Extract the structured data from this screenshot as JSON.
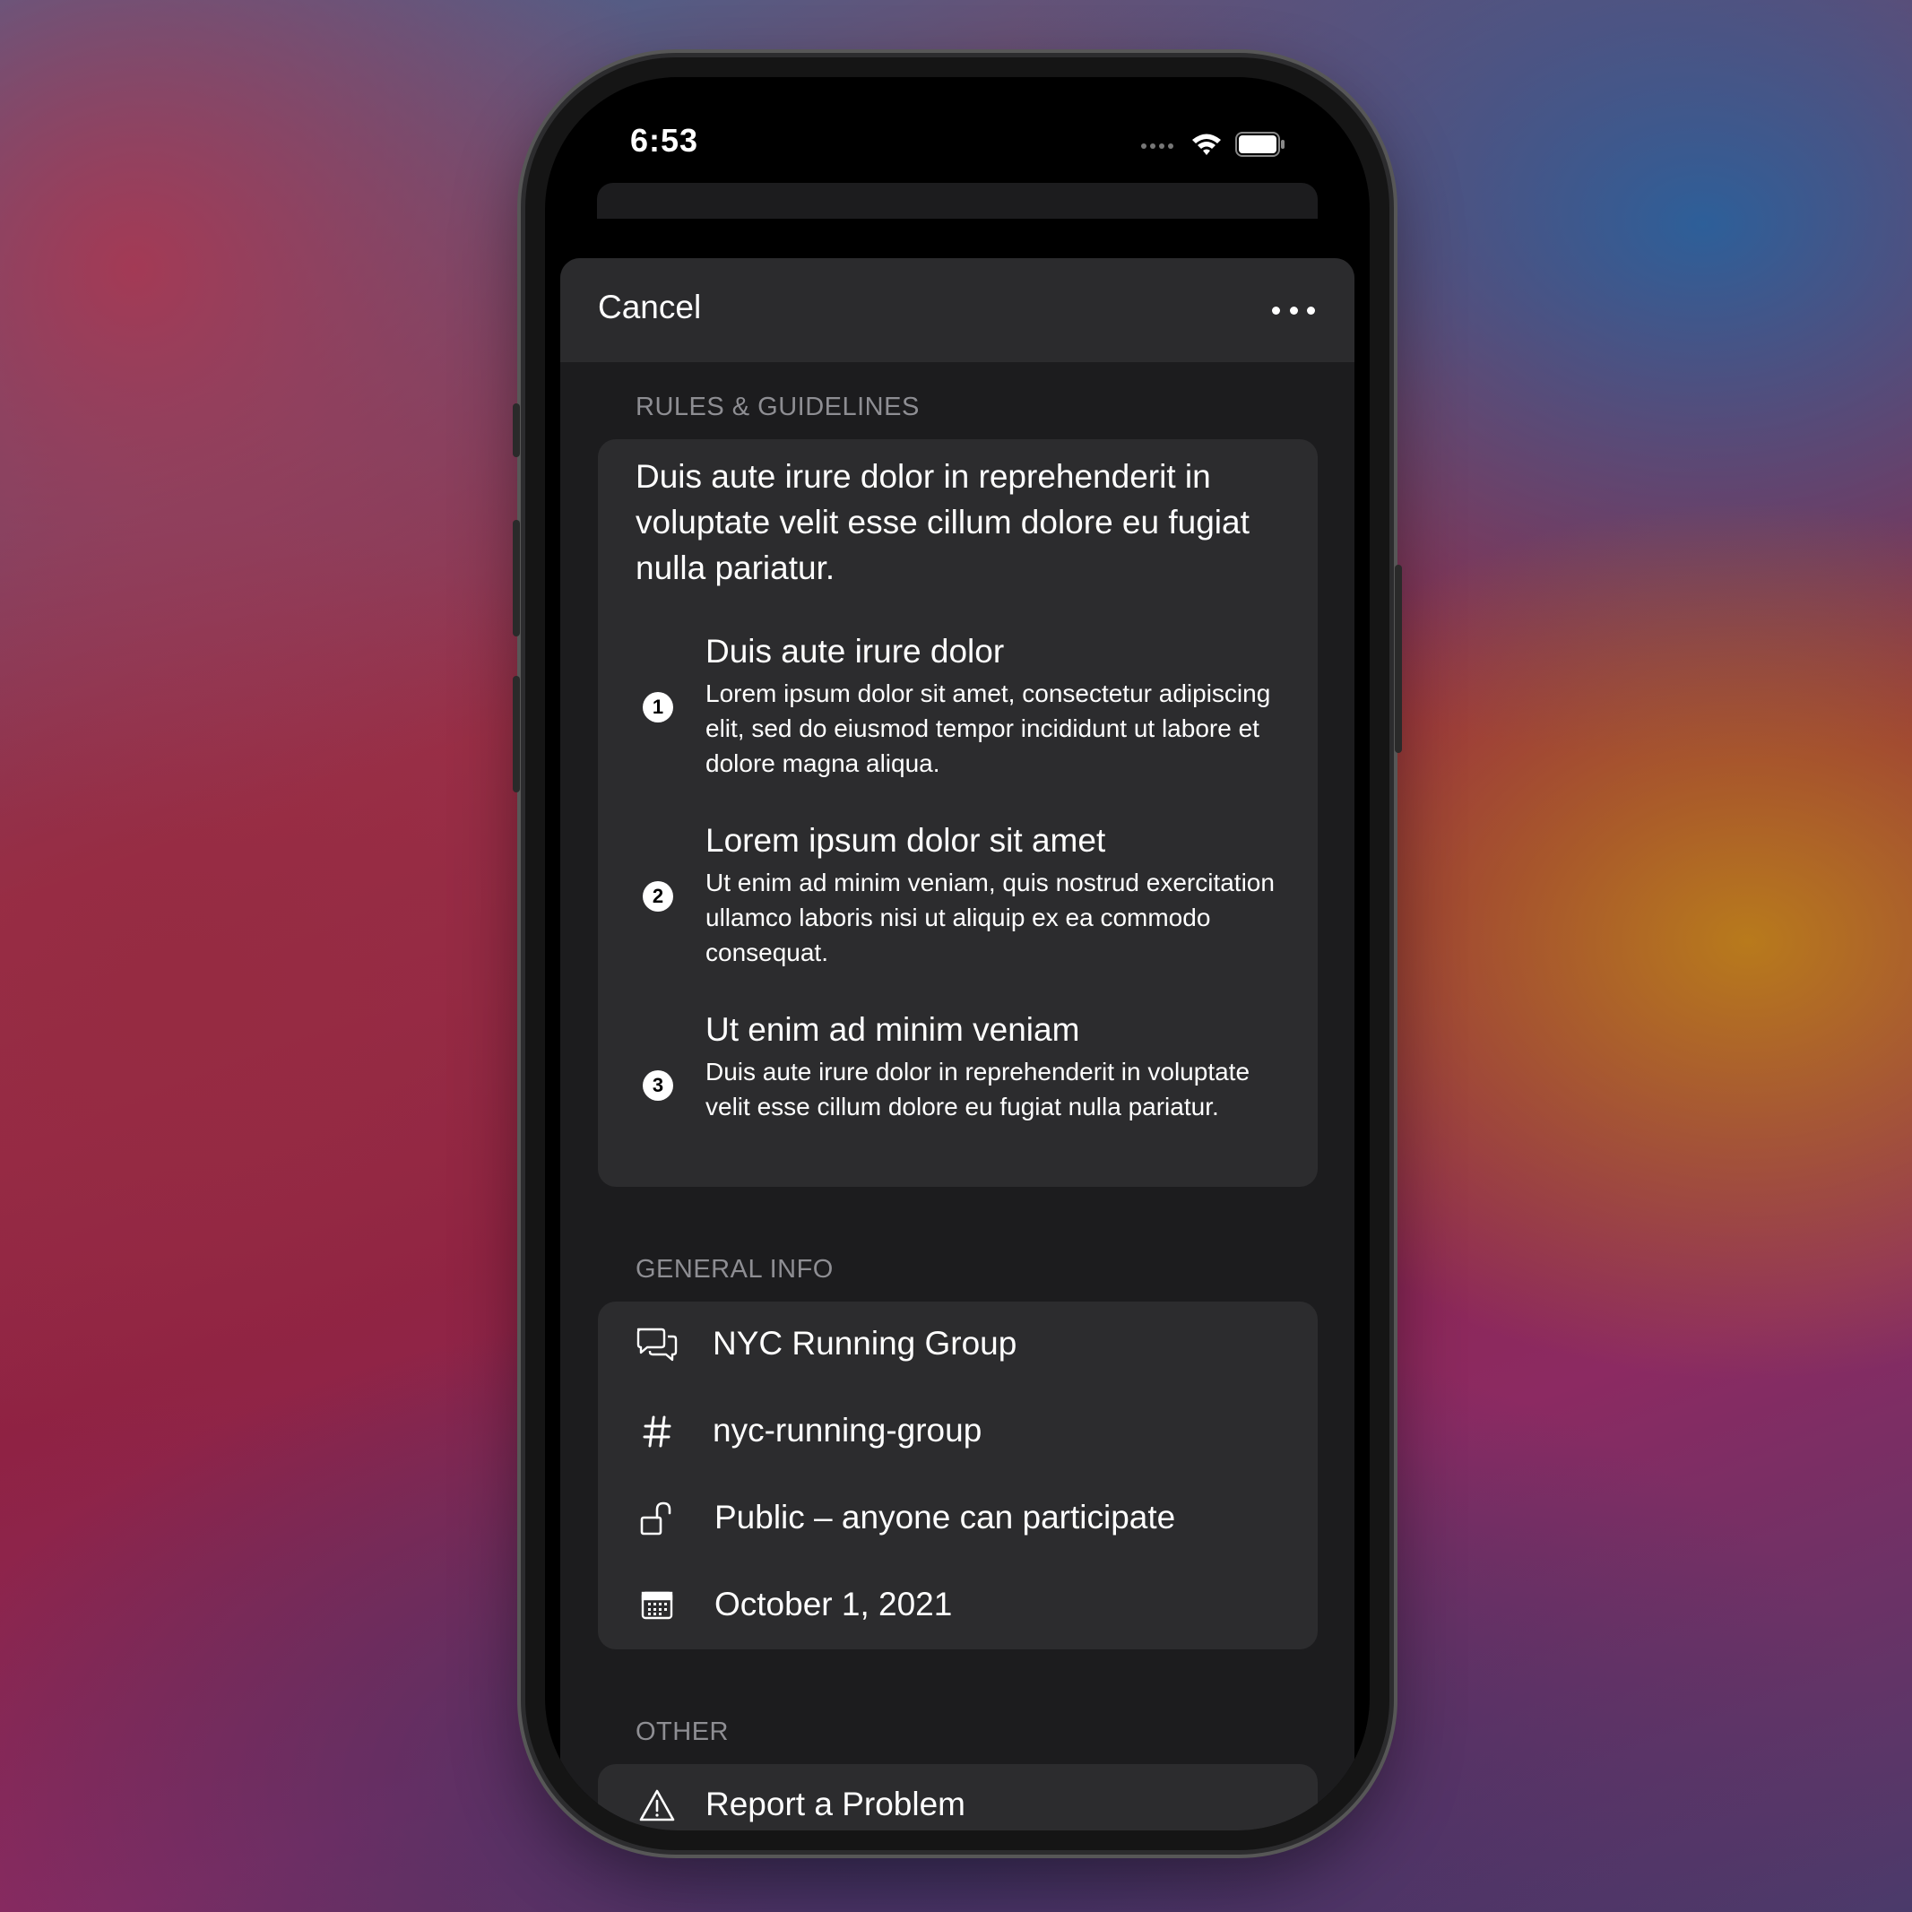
{
  "status_bar": {
    "time": "6:53",
    "icons": [
      "signal-icon",
      "wifi-icon",
      "battery-icon"
    ]
  },
  "nav": {
    "cancel_label": "Cancel",
    "more_icon": "ellipsis-icon"
  },
  "rules_section": {
    "header": "RULES & GUIDELINES",
    "intro": "Duis aute irure dolor in reprehenderit in voluptate velit esse cillum dolore eu fugiat nulla pariatur.",
    "rules": [
      {
        "number": "1",
        "title": "Duis aute irure dolor",
        "description": "Lorem ipsum dolor sit amet, consectetur adipiscing elit, sed do eiusmod tempor incididunt ut labore et dolore magna aliqua."
      },
      {
        "number": "2",
        "title": "Lorem ipsum dolor sit amet",
        "description": "Ut enim ad minim veniam, quis nostrud exercitation ullamco laboris nisi ut aliquip ex ea commodo consequat."
      },
      {
        "number": "3",
        "title": "Ut enim ad minim veniam",
        "description": "Duis aute irure dolor in reprehenderit in voluptate velit esse cillum dolore eu fugiat nulla pariatur."
      }
    ]
  },
  "general_section": {
    "header": "GENERAL INFO",
    "items": [
      {
        "icon": "chat-bubbles-icon",
        "text": "NYC Running Group"
      },
      {
        "icon": "hashtag-icon",
        "text": "nyc-running-group"
      },
      {
        "icon": "unlock-icon",
        "text": "Public – anyone can participate"
      },
      {
        "icon": "calendar-icon",
        "text": "October 1, 2021"
      }
    ]
  },
  "other_section": {
    "header": "OTHER",
    "items": [
      {
        "icon": "warning-icon",
        "text": "Report a Problem"
      }
    ]
  },
  "colors": {
    "background": "#1c1c1e",
    "card": "#2c2c2e",
    "navbar": "#2b2b2d",
    "secondary_text": "#8e8e93",
    "text": "#ffffff"
  }
}
